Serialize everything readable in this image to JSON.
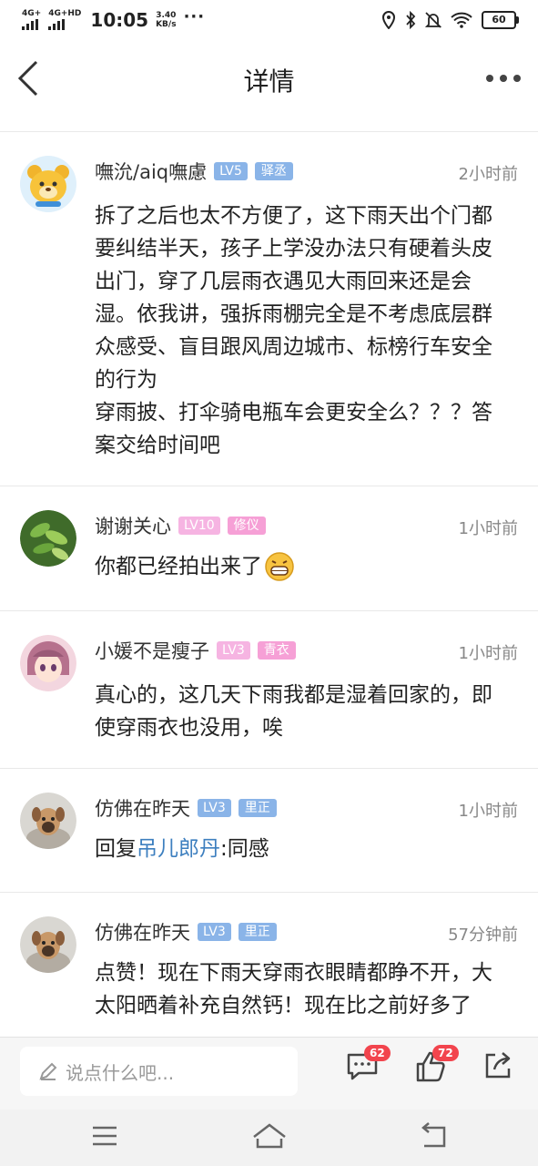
{
  "status_bar": {
    "network1": "4G+",
    "network2": "4G+HD",
    "time": "10:05",
    "speed_value": "3.40",
    "speed_unit": "KB/s",
    "more": "···",
    "battery": "60"
  },
  "header": {
    "title": "详情",
    "back_icon": "chevron-left-icon",
    "more_icon": "more-horizontal-icon"
  },
  "comments": [
    {
      "username": "嘸沇/aiq嘸慮",
      "level": "LV5",
      "level_color": "#8ab4e8",
      "role": "驿丞",
      "role_color": "#8ab4e8",
      "time": "2小时前",
      "content": "拆了之后也太不方便了，这下雨天出个门都要纠结半天，孩子上学没办法只有硬着头皮出门，穿了几层雨衣遇见大雨回来还是会湿。依我讲，强拆雨棚完全是不考虑底层群众感受、盲目跟风周边城市、标榜行车安全的行为\n穿雨披、打伞骑电瓶车会更安全么？？？答案交给时间吧"
    },
    {
      "username": "谢谢关心",
      "level": "LV10",
      "level_color": "#f6b4e2",
      "role": "修仪",
      "role_color": "#f6a0d6",
      "time": "1小时前",
      "content": "你都已经拍出来了",
      "emoji": "grinning-face-icon"
    },
    {
      "username": "小媛不是瘦子",
      "level": "LV3",
      "level_color": "#f6b4e2",
      "role": "青衣",
      "role_color": "#f6a0d6",
      "time": "1小时前",
      "content": "真心的，这几天下雨我都是湿着回家的，即使穿雨衣也没用，唉"
    },
    {
      "username": "仿佛在昨天",
      "level": "LV3",
      "level_color": "#8ab4e8",
      "role": "里正",
      "role_color": "#8ab4e8",
      "time": "1小时前",
      "reply_prefix": "回复",
      "reply_to": "吊儿郎丹",
      "content": ":同感"
    },
    {
      "username": "仿佛在昨天",
      "level": "LV3",
      "level_color": "#8ab4e8",
      "role": "里正",
      "role_color": "#8ab4e8",
      "time": "57分钟前",
      "content": "点赞！现在下雨天穿雨衣眼睛都睁不开，大太阳晒着补充自然钙！现在比之前好多了"
    }
  ],
  "bottom_bar": {
    "input_placeholder": "说点什么吧...",
    "comment_count": "62",
    "like_count": "72",
    "share_icon": "share-icon"
  },
  "nav_bar": {
    "menu_icon": "menu-icon",
    "home_icon": "home-icon",
    "back_icon": "back-icon"
  }
}
